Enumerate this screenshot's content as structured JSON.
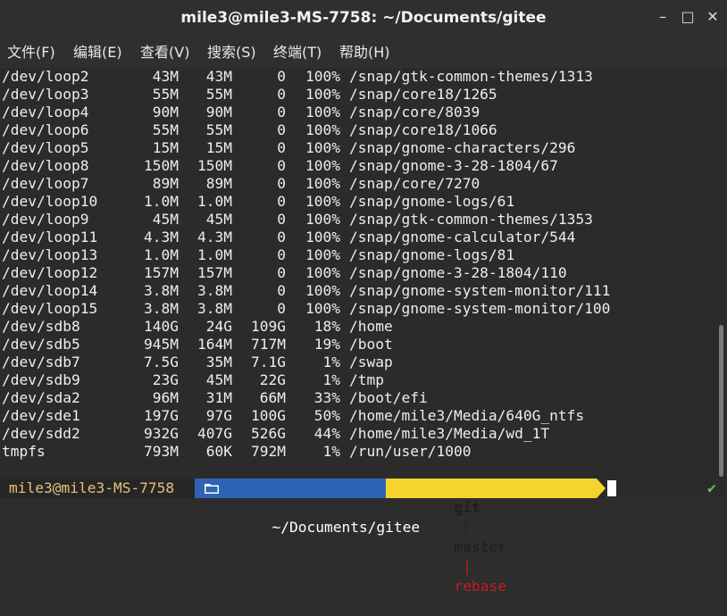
{
  "window": {
    "title": "mile3@mile3-MS-7758: ~/Documents/gitee",
    "minimize": "–",
    "maximize": "□",
    "close": "✕"
  },
  "menu": [
    "文件(F)",
    "编辑(E)",
    "查看(V)",
    "搜索(S)",
    "终端(T)",
    "帮助(H)"
  ],
  "rows": [
    [
      "/dev/loop2",
      "43M",
      "43M",
      "0",
      "100%",
      "/snap/gtk-common-themes/1313"
    ],
    [
      "/dev/loop3",
      "55M",
      "55M",
      "0",
      "100%",
      "/snap/core18/1265"
    ],
    [
      "/dev/loop4",
      "90M",
      "90M",
      "0",
      "100%",
      "/snap/core/8039"
    ],
    [
      "/dev/loop6",
      "55M",
      "55M",
      "0",
      "100%",
      "/snap/core18/1066"
    ],
    [
      "/dev/loop5",
      "15M",
      "15M",
      "0",
      "100%",
      "/snap/gnome-characters/296"
    ],
    [
      "/dev/loop8",
      "150M",
      "150M",
      "0",
      "100%",
      "/snap/gnome-3-28-1804/67"
    ],
    [
      "/dev/loop7",
      "89M",
      "89M",
      "0",
      "100%",
      "/snap/core/7270"
    ],
    [
      "/dev/loop10",
      "1.0M",
      "1.0M",
      "0",
      "100%",
      "/snap/gnome-logs/61"
    ],
    [
      "/dev/loop9",
      "45M",
      "45M",
      "0",
      "100%",
      "/snap/gtk-common-themes/1353"
    ],
    [
      "/dev/loop11",
      "4.3M",
      "4.3M",
      "0",
      "100%",
      "/snap/gnome-calculator/544"
    ],
    [
      "/dev/loop13",
      "1.0M",
      "1.0M",
      "0",
      "100%",
      "/snap/gnome-logs/81"
    ],
    [
      "/dev/loop12",
      "157M",
      "157M",
      "0",
      "100%",
      "/snap/gnome-3-28-1804/110"
    ],
    [
      "/dev/loop14",
      "3.8M",
      "3.8M",
      "0",
      "100%",
      "/snap/gnome-system-monitor/111"
    ],
    [
      "/dev/loop15",
      "3.8M",
      "3.8M",
      "0",
      "100%",
      "/snap/gnome-system-monitor/100"
    ],
    [
      "/dev/sdb8",
      "140G",
      "24G",
      "109G",
      "18%",
      "/home"
    ],
    [
      "/dev/sdb5",
      "945M",
      "164M",
      "717M",
      "19%",
      "/boot"
    ],
    [
      "/dev/sdb7",
      "7.5G",
      "35M",
      "7.1G",
      "1%",
      "/swap"
    ],
    [
      "/dev/sdb9",
      "23G",
      "45M",
      "22G",
      "1%",
      "/tmp"
    ],
    [
      "/dev/sda2",
      "96M",
      "31M",
      "66M",
      "33%",
      "/boot/efi"
    ],
    [
      "/dev/sde1",
      "197G",
      "97G",
      "100G",
      "50%",
      "/home/mile3/Media/640G_ntfs"
    ],
    [
      "/dev/sdd2",
      "932G",
      "407G",
      "526G",
      "44%",
      "/home/mile3/Media/wd_1T"
    ],
    [
      "tmpfs",
      "793M",
      "60K",
      "792M",
      "1%",
      "/run/user/1000"
    ]
  ],
  "prompt": {
    "user": "mile3@mile3-MS-7758",
    "folder_icon": "folder-icon",
    "path": "~/Documents/gitee",
    "git_label": "git",
    "branch_icon": "branch-icon",
    "branch": "master",
    "separator": "|",
    "state": "rebase",
    "status": "✔"
  },
  "colors": {
    "path_bg": "#2f63b5",
    "git_bg": "#f5d52d",
    "user_fg": "#e5c07b",
    "ok_fg": "#59d13f"
  }
}
